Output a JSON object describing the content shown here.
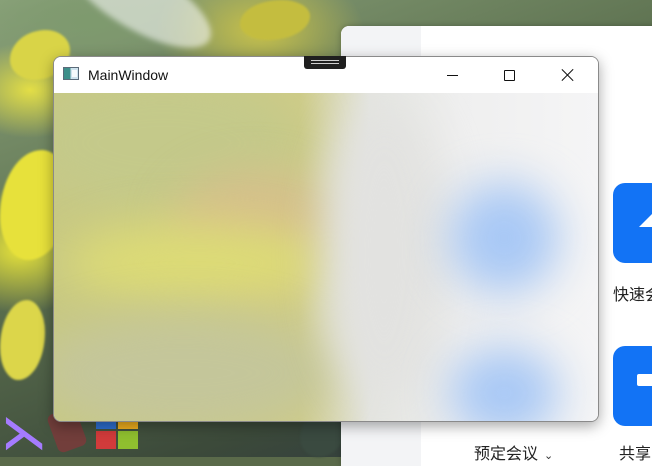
{
  "window": {
    "title": "MainWindow",
    "controls": {
      "minimize": "minimize",
      "maximize": "maximize",
      "close": "close"
    }
  },
  "background_app": {
    "actions": [
      {
        "label": "快速会",
        "icon": "upload-arrow-icon"
      },
      {
        "label": "共享",
        "icon": "share-screen-icon"
      }
    ],
    "schedule_label": "预定会议",
    "schedule_chevron": "⌄",
    "accent_color": "#1273f5"
  },
  "colors": {
    "client_left": "#cfcc88",
    "client_right": "#f5f5f6",
    "blob_blue": "#a8c8f5"
  }
}
